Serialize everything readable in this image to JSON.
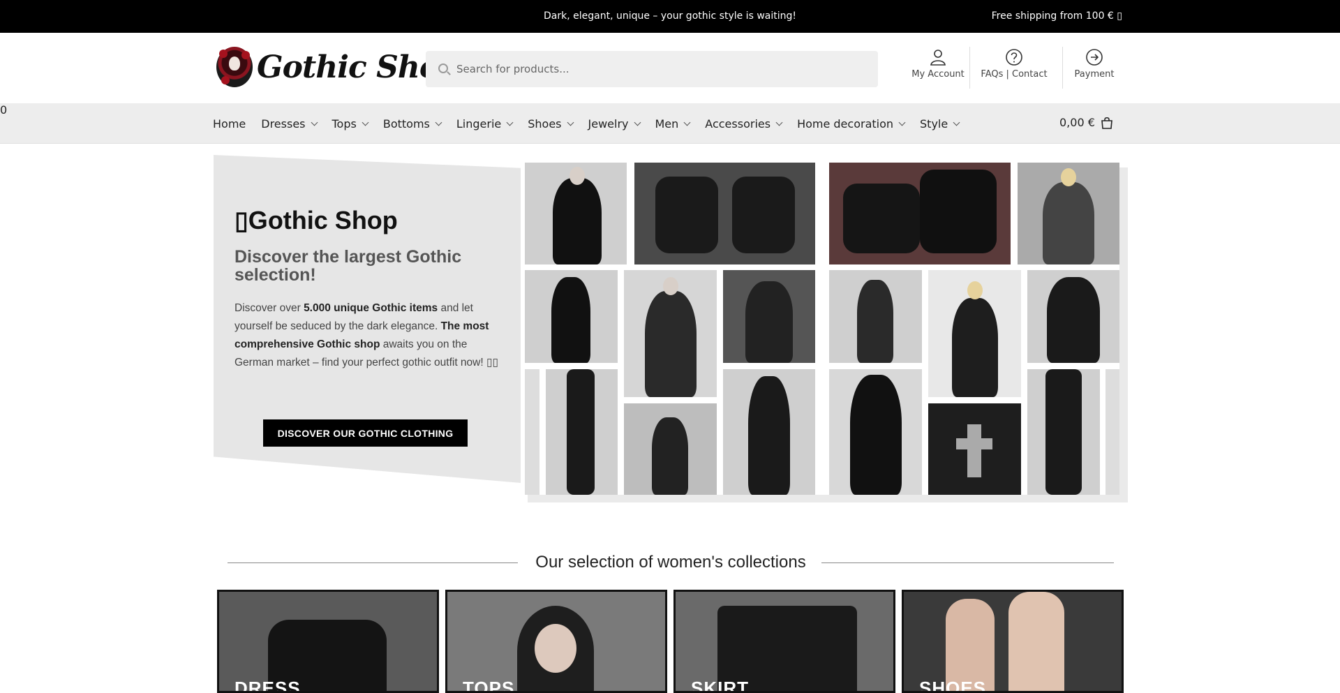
{
  "topbar": {
    "message": "Dark, elegant, unique – your gothic style is waiting!",
    "shipping": "Free shipping from 100 € ▯"
  },
  "header": {
    "logo_text": "Gothic Shop",
    "search_placeholder": "Search for products...",
    "links": {
      "account": "My Account",
      "faq": "FAQs | Contact",
      "payment": "Payment"
    }
  },
  "nav": {
    "items": [
      {
        "label": "Home",
        "has_menu": false
      },
      {
        "label": "Dresses",
        "has_menu": true
      },
      {
        "label": "Tops",
        "has_menu": true
      },
      {
        "label": "Bottoms",
        "has_menu": true
      },
      {
        "label": "Lingerie",
        "has_menu": true
      },
      {
        "label": "Shoes",
        "has_menu": true
      },
      {
        "label": "Jewelry",
        "has_menu": true
      },
      {
        "label": "Men",
        "has_menu": true
      },
      {
        "label": "Accessories",
        "has_menu": true
      },
      {
        "label": "Home decoration",
        "has_menu": true
      },
      {
        "label": "Style",
        "has_menu": true
      }
    ],
    "cart_total": "0,00 €",
    "cart_count": "0"
  },
  "hero": {
    "title": "▯Gothic Shop",
    "subtitle": "Discover the largest Gothic selection!",
    "desc_1": "Discover over ",
    "desc_bold_1": "5.000 unique Gothic items",
    "desc_2": " and let yourself be seduced by the dark elegance. ",
    "desc_bold_2": "The most comprehensive Gothic shop",
    "desc_3": " awaits you on the German market – find your perfect gothic outfit now! ▯▯",
    "button": "DISCOVER OUR GOTHIC CLOTHING"
  },
  "collections": {
    "title": "Our selection of women's collections",
    "items": [
      {
        "label": "DRESS"
      },
      {
        "label": "TOPS"
      },
      {
        "label": "SKIRT"
      },
      {
        "label": "SHOES"
      }
    ]
  },
  "colors": {
    "topbar_bg": "#000000",
    "nav_bg": "#ededed",
    "button_bg": "#000000"
  }
}
